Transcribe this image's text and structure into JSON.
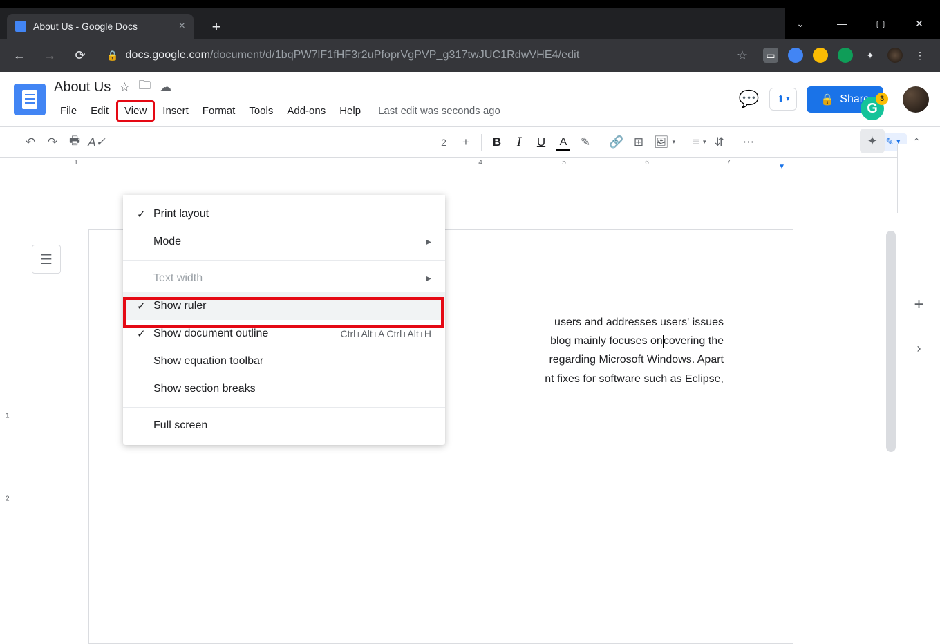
{
  "browser": {
    "tab_title": "About Us - Google Docs",
    "url_host": "docs.google.com",
    "url_path": "/document/d/1bqPW7lF1fHF3r2uPfoprVgPVP_g317twJUC1RdwVHE4/edit"
  },
  "docs": {
    "title": "About Us",
    "menus": {
      "file": "File",
      "edit": "Edit",
      "view": "View",
      "insert": "Insert",
      "format": "Format",
      "tools": "Tools",
      "addons": "Add-ons",
      "help": "Help",
      "last_edit": "Last edit was seconds ago"
    },
    "share_label": "Share"
  },
  "toolbar": {
    "zoom": "",
    "font_size_plus": "+"
  },
  "dropdown": {
    "print_layout": "Print layout",
    "mode": "Mode",
    "text_width": "Text width",
    "show_ruler": "Show ruler",
    "show_outline": "Show document outline",
    "show_outline_shortcut": "Ctrl+Alt+A Ctrl+Alt+H",
    "show_equation": "Show equation toolbar",
    "show_section": "Show section breaks",
    "full_screen": "Full screen"
  },
  "ruler": {
    "h1": "1",
    "h4": "4",
    "h5": "5",
    "h6": "6",
    "h7": "7",
    "v1": "1",
    "v2": "2"
  },
  "document": {
    "line1_suffix": "users and addresses users' issues",
    "line2_suffix_a": " blog mainly focuses on",
    "line2_suffix_b": "covering the",
    "line3_suffix": " regarding Microsoft Windows. Apart",
    "line4_suffix": "nt fixes for software such as Eclipse,"
  },
  "grammarly_badge": "3"
}
